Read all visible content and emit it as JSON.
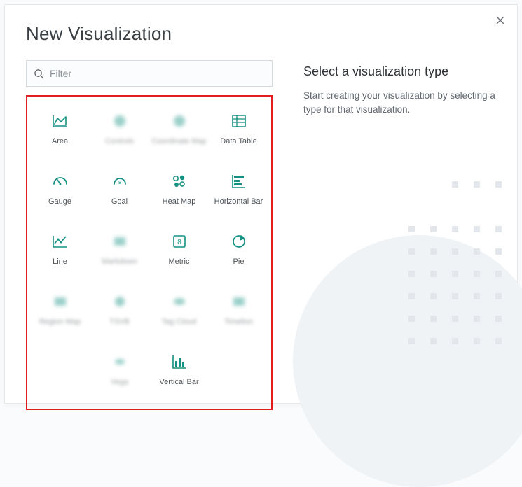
{
  "modal": {
    "title": "New Visualization",
    "close_aria": "Close"
  },
  "filter": {
    "placeholder": "Filter"
  },
  "side": {
    "heading": "Select a visualization type",
    "desc": "Start creating your visualization by selecting a type for that visualization."
  },
  "viz": {
    "area": "Area",
    "controls": "Controls",
    "coordmap": "Coordinate Map",
    "datatable": "Data Table",
    "gauge": "Gauge",
    "goal": "Goal",
    "heatmap": "Heat Map",
    "hbar": "Horizontal Bar",
    "line": "Line",
    "markdown": "Markdown",
    "metric": "Metric",
    "pie": "Pie",
    "regionmap": "Region Map",
    "tsvb": "TSVB",
    "tagcloud": "Tag Cloud",
    "timelion": "Timelion",
    "vega": "Vega",
    "vbar": "Vertical Bar"
  }
}
